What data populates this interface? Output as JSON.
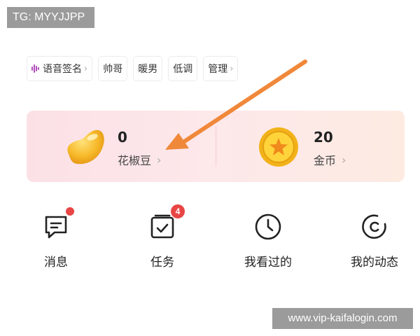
{
  "watermarks": {
    "top": "TG: MYYJJPP",
    "bottom": "www.vip-kaifalogin.com"
  },
  "tags": [
    {
      "label": "语音签名",
      "chevron": "›",
      "icon": "audio-wave-icon"
    },
    {
      "label": "帅哥"
    },
    {
      "label": "暖男"
    },
    {
      "label": "低调"
    },
    {
      "label": "管理",
      "chevron": "›"
    }
  ],
  "wallet": {
    "beans": {
      "value": "0",
      "label": "花椒豆",
      "chevron": "›",
      "icon": "bean-icon"
    },
    "coins": {
      "value": "20",
      "label": "金币",
      "chevron": "›",
      "icon": "gold-coin-icon"
    }
  },
  "shortcuts": [
    {
      "label": "消息",
      "icon": "message-icon",
      "has_dot": true
    },
    {
      "label": "任务",
      "icon": "task-icon",
      "badge": "4"
    },
    {
      "label": "我看过的",
      "icon": "clock-icon"
    },
    {
      "label": "我的动态",
      "icon": "activity-icon"
    }
  ],
  "colors": {
    "accent_red": "#e84545",
    "arrow": "#f0883a",
    "wallet_bg": "#fde8ea",
    "tag_wave": "#b24dba"
  }
}
